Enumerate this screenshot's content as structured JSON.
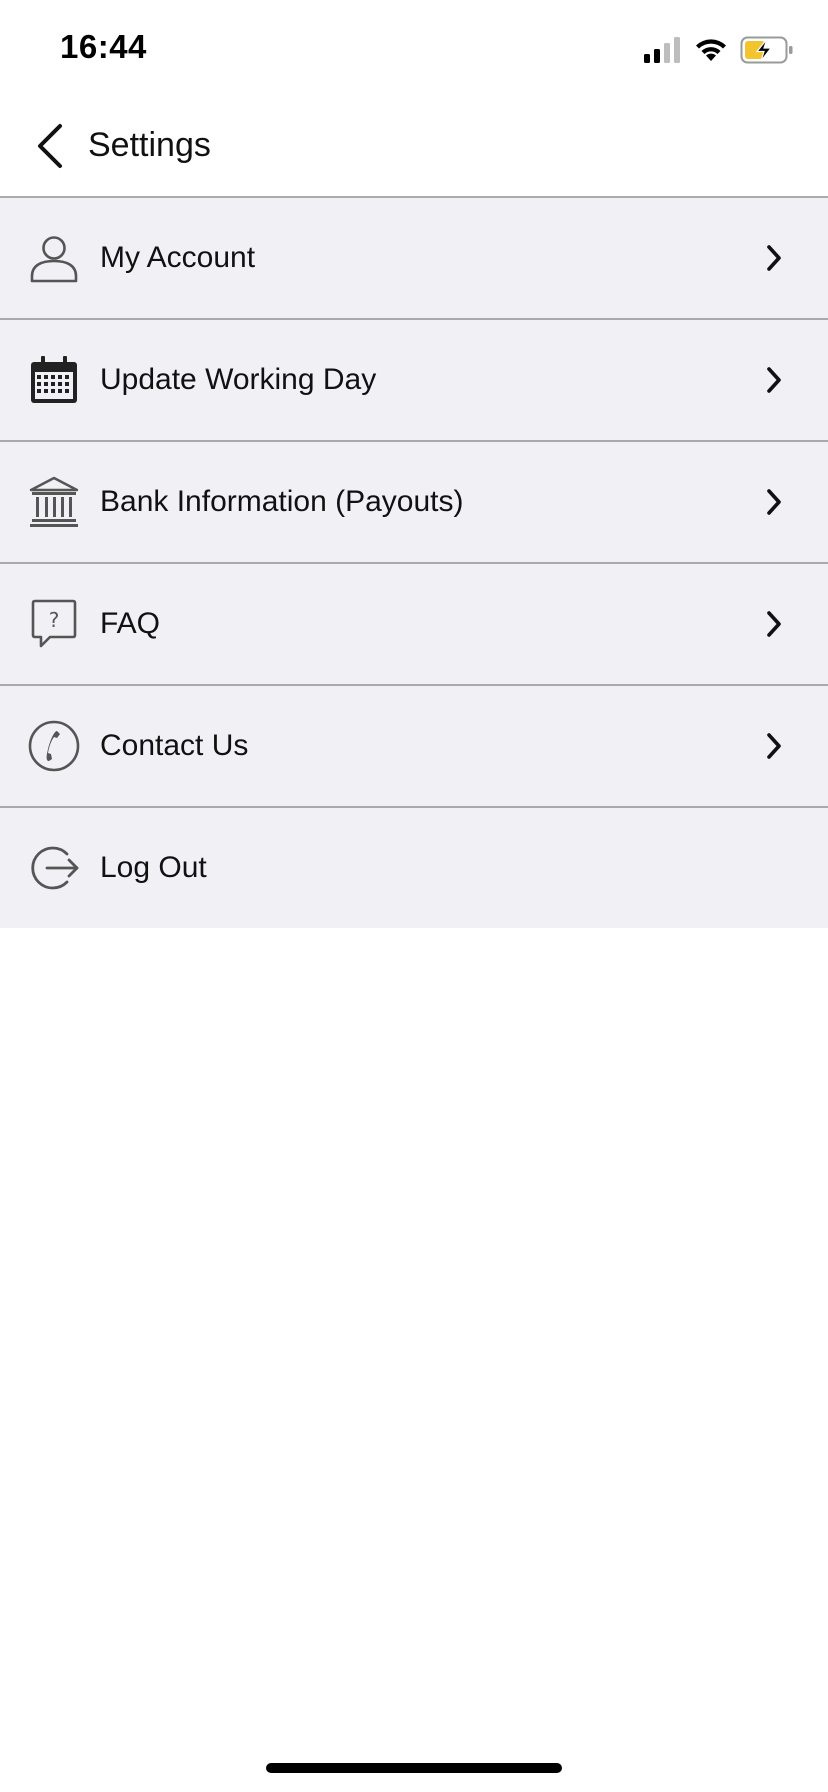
{
  "status_bar": {
    "time": "16:44",
    "icons": [
      "cellular-signal-icon",
      "wifi-icon",
      "battery-charging-icon"
    ],
    "battery_color": "#f2c52e"
  },
  "header": {
    "title": "Settings",
    "back_icon": "chevron-left-icon"
  },
  "settings": {
    "items": [
      {
        "label": "My Account",
        "icon": "user-icon",
        "has_chevron": true
      },
      {
        "label": "Update Working Day",
        "icon": "calendar-icon",
        "has_chevron": true
      },
      {
        "label": "Bank Information (Payouts)",
        "icon": "bank-icon",
        "has_chevron": true
      },
      {
        "label": "FAQ",
        "icon": "question-bubble-icon",
        "has_chevron": true
      },
      {
        "label": "Contact Us",
        "icon": "phone-icon",
        "has_chevron": true
      },
      {
        "label": "Log Out",
        "icon": "logout-icon",
        "has_chevron": false
      }
    ]
  },
  "colors": {
    "list_background": "#f0f0f5",
    "divider": "#a9a9ae",
    "icon_gray": "#555555",
    "text": "#111111"
  }
}
